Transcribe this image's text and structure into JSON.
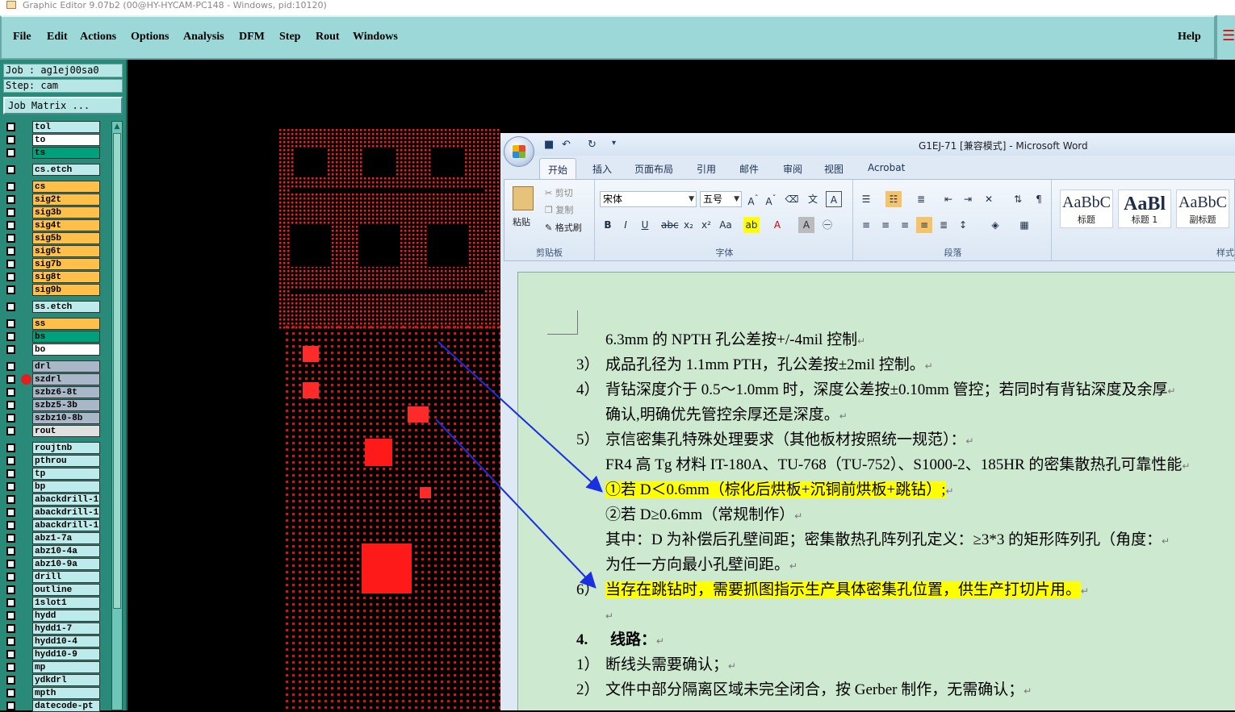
{
  "window": {
    "title": "Graphic Editor 9.07b2 (00@HY-HYCAM-PC148 - Windows, pid:10120)"
  },
  "menu": {
    "items": [
      "File",
      "Edit",
      "Actions",
      "Options",
      "Analysis",
      "DFM",
      "Step",
      "Rout",
      "Windows"
    ],
    "help": "Help"
  },
  "panel": {
    "job": "Job : ag1ej00sa0",
    "step": "Step: cam",
    "job_matrix": "Job Matrix ..."
  },
  "layers": [
    {
      "name": "tol",
      "color": "#bdeaea"
    },
    {
      "name": "to",
      "color": "#ffffff"
    },
    {
      "name": "ts",
      "color": "#00a07a"
    },
    {
      "name": "cs.etch",
      "color": "#bdeaea"
    },
    {
      "name": "cs",
      "color": "#ffc04a"
    },
    {
      "name": "sig2t",
      "color": "#ffc04a"
    },
    {
      "name": "sig3b",
      "color": "#ffc04a"
    },
    {
      "name": "sig4t",
      "color": "#ffc04a"
    },
    {
      "name": "sig5b",
      "color": "#ffc04a"
    },
    {
      "name": "sig6t",
      "color": "#ffc04a"
    },
    {
      "name": "sig7b",
      "color": "#ffc04a"
    },
    {
      "name": "sig8t",
      "color": "#ffc04a"
    },
    {
      "name": "sig9b",
      "color": "#ffc04a"
    },
    {
      "name": "ss.etch",
      "color": "#bdeaea"
    },
    {
      "name": "ss",
      "color": "#ffc04a"
    },
    {
      "name": "bs",
      "color": "#00a07a"
    },
    {
      "name": "bo",
      "color": "#ffffff"
    },
    {
      "name": "drl",
      "color": "#a8b8c8"
    },
    {
      "name": "szdrl",
      "color": "#a8b8c8",
      "selected": true
    },
    {
      "name": "szbz6-8t",
      "color": "#a8b8c8"
    },
    {
      "name": "szbz5-3b",
      "color": "#a8b8c8"
    },
    {
      "name": "szbz10-8b",
      "color": "#a8b8c8"
    },
    {
      "name": "rout",
      "color": "#e0e0e0"
    },
    {
      "name": "roujtnb",
      "color": "#bdeaea"
    },
    {
      "name": "pthrou",
      "color": "#bdeaea"
    },
    {
      "name": "tp",
      "color": "#bdeaea"
    },
    {
      "name": "bp",
      "color": "#bdeaea"
    },
    {
      "name": "abackdrill-1",
      "color": "#bdeaea"
    },
    {
      "name": "abackdrill-1",
      "color": "#bdeaea"
    },
    {
      "name": "abackdrill-1",
      "color": "#bdeaea"
    },
    {
      "name": "abz1-7a",
      "color": "#bdeaea"
    },
    {
      "name": "abz10-4a",
      "color": "#bdeaea"
    },
    {
      "name": "abz10-9a",
      "color": "#bdeaea"
    },
    {
      "name": "drill",
      "color": "#bdeaea"
    },
    {
      "name": "outline",
      "color": "#bdeaea"
    },
    {
      "name": "1slot1",
      "color": "#bdeaea"
    },
    {
      "name": "hydd",
      "color": "#bdeaea"
    },
    {
      "name": "hydd1-7",
      "color": "#bdeaea"
    },
    {
      "name": "hydd10-4",
      "color": "#bdeaea"
    },
    {
      "name": "hydd10-9",
      "color": "#bdeaea"
    },
    {
      "name": "mp",
      "color": "#bdeaea"
    },
    {
      "name": "ydkdrl",
      "color": "#bdeaea"
    },
    {
      "name": "mpth",
      "color": "#bdeaea"
    },
    {
      "name": "datecode-pt",
      "color": "#bdeaea"
    }
  ],
  "word": {
    "title": "G1EJ-71 [兼容模式] - Microsoft Word",
    "tabs": [
      "开始",
      "插入",
      "页面布局",
      "引用",
      "邮件",
      "审阅",
      "视图",
      "Acrobat"
    ],
    "clipboard": {
      "paste": "粘贴",
      "cut": "剪切",
      "copy": "复制",
      "format_painter": "格式刷",
      "label": "剪贴板"
    },
    "font": {
      "name": "宋体",
      "size": "五号",
      "label": "字体"
    },
    "paragraph": {
      "label": "段落"
    },
    "styles": {
      "items": [
        {
          "sample": "AaBbC",
          "name": "标题"
        },
        {
          "sample": "AaBl",
          "name": "标题 1"
        },
        {
          "sample": "AaBbC",
          "name": "副标题"
        }
      ],
      "label": "样式"
    },
    "lines": [
      {
        "num": "",
        "text": "6.3mm 的 NPTH 孔公差按+/-4mil 控制",
        "hl": false
      },
      {
        "num": "3）",
        "text": "成品孔径为 1.1mm PTH，孔公差按±2mil 控制。",
        "hl": false
      },
      {
        "num": "4）",
        "text": "背钻深度介于 0.5～1.0mm 时，深度公差按±0.10mm 管控；若同时有背钻深度及余厚",
        "hl": false
      },
      {
        "num": "",
        "text": "确认,明确优先管控余厚还是深度。",
        "hl": false
      },
      {
        "num": "5）",
        "text": "京信密集孔特殊处理要求（其他板材按照统一规范）：",
        "hl": false
      },
      {
        "num": "",
        "text": "FR4 高 Tg 材料 IT-180A、TU-768（TU-752）、S1000-2、185HR 的密集散热孔可靠性能",
        "hl": false
      },
      {
        "num": "",
        "text": "①若 D＜0.6mm（棕化后烘板+沉铜前烘板+跳钻）;",
        "hl": true
      },
      {
        "num": "",
        "text": "②若 D≥0.6mm（常规制作）",
        "hl": false
      },
      {
        "num": "",
        "text": "其中：D 为补偿后孔壁间距；密集散热孔阵列孔定义：≥3*3 的矩形阵列孔（角度：",
        "hl": false
      },
      {
        "num": "",
        "text": "为任一方向最小孔壁间距。",
        "hl": false
      },
      {
        "num": "6）",
        "text": "当存在跳钻时，需要抓图指示生产具体密集孔位置，供生产打切片用。",
        "hl": true
      },
      {
        "num": "",
        "text": "",
        "hl": false
      },
      {
        "num": "4.",
        "text": "线路：",
        "hl": false
      },
      {
        "num": "1）",
        "text": "断线头需要确认；",
        "hl": false
      },
      {
        "num": "2）",
        "text": "文件中部分隔离区域未完全闭合，按 Gerber 制作，无需确认；",
        "hl": false
      }
    ]
  }
}
